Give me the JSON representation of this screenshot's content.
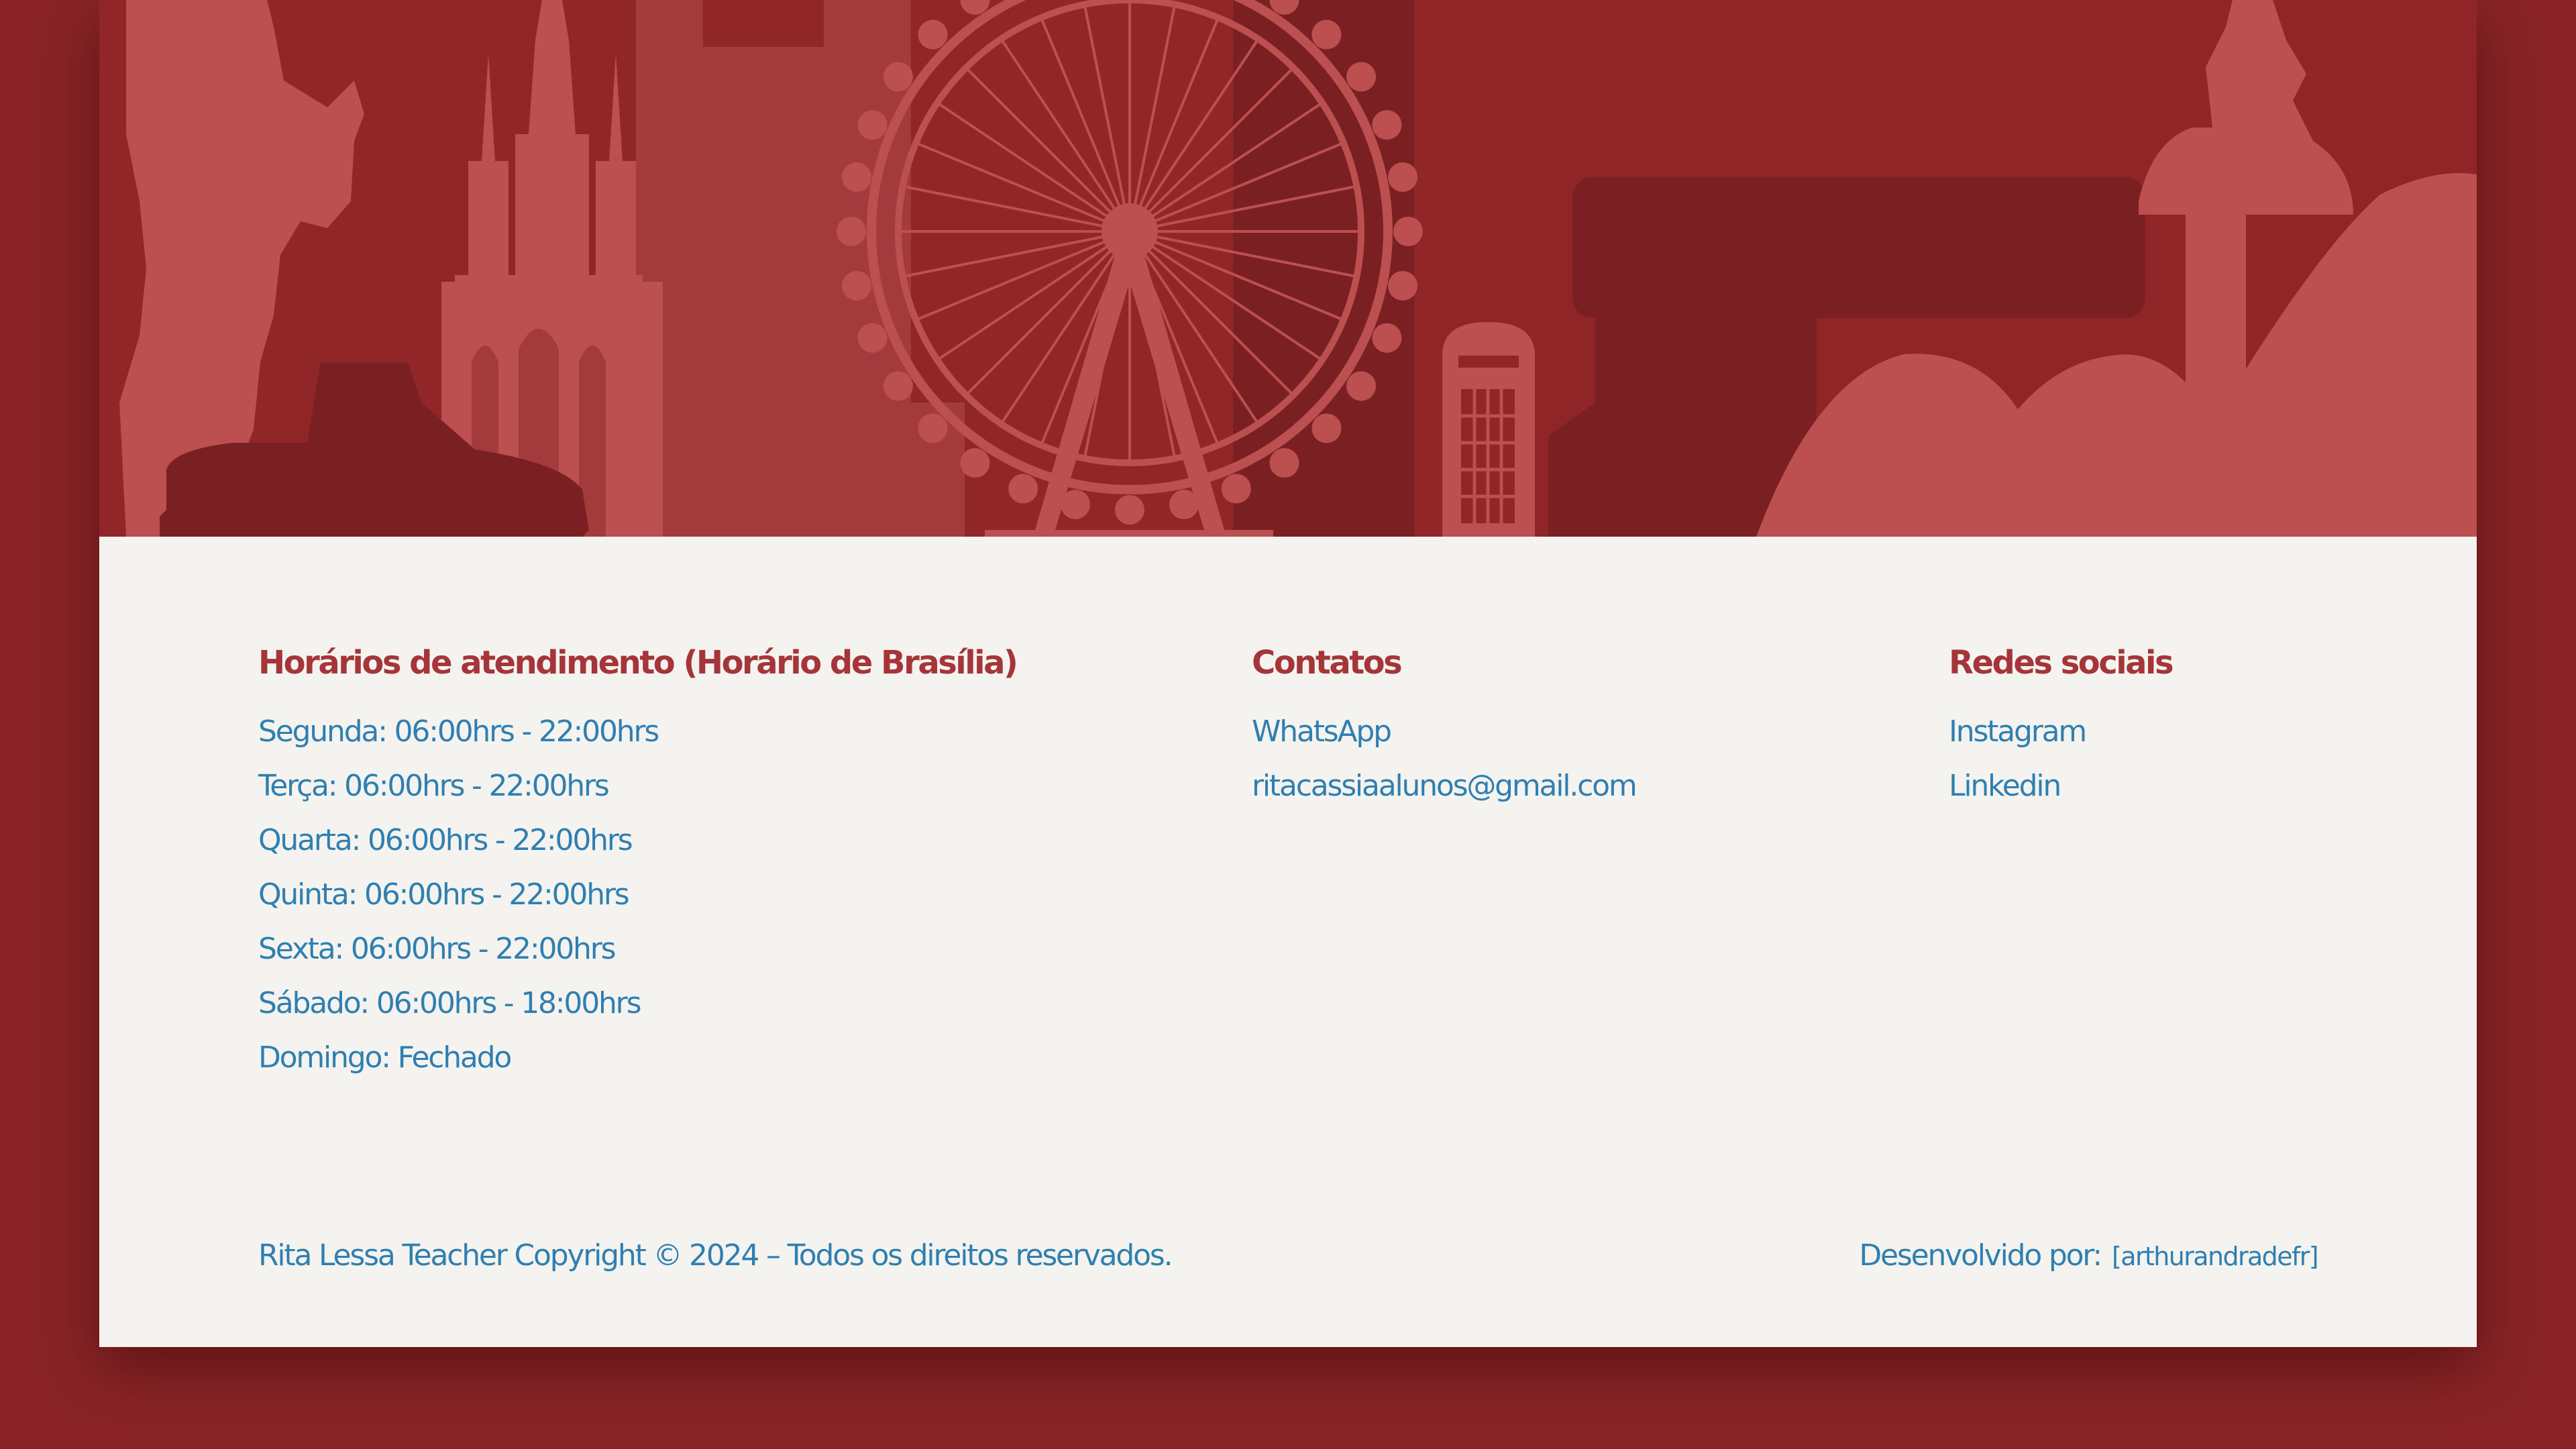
{
  "colors": {
    "page_background": "#8a2426",
    "footer_background": "#f4f3ef",
    "heading": "#a53539",
    "link_text": "#2f7fb1",
    "skyline_light": "#bc4f4f",
    "skyline_mid": "#a33b3d",
    "skyline_dark": "#7b2022"
  },
  "hero": {
    "illustration": "london-skyline-illustration"
  },
  "footer": {
    "hours": {
      "title": "Horários de atendimento (Horário de Brasília)",
      "items": [
        "Segunda: 06:00hrs - 22:00hrs",
        "Terça: 06:00hrs - 22:00hrs",
        "Quarta: 06:00hrs - 22:00hrs",
        "Quinta: 06:00hrs - 22:00hrs",
        "Sexta: 06:00hrs - 22:00hrs",
        "Sábado: 06:00hrs - 18:00hrs",
        "Domingo: Fechado"
      ]
    },
    "contacts": {
      "title": "Contatos",
      "items": [
        "WhatsApp",
        "ritacassiaalunos@gmail.com"
      ]
    },
    "social": {
      "title": "Redes sociais",
      "items": [
        "Instagram",
        "Linkedin"
      ]
    },
    "copyright": "Rita Lessa Teacher Copyright © 2024 – Todos os direitos reservados.",
    "developer": {
      "label": "Desenvolvido por:",
      "name": "[arthurandradefr]"
    }
  }
}
